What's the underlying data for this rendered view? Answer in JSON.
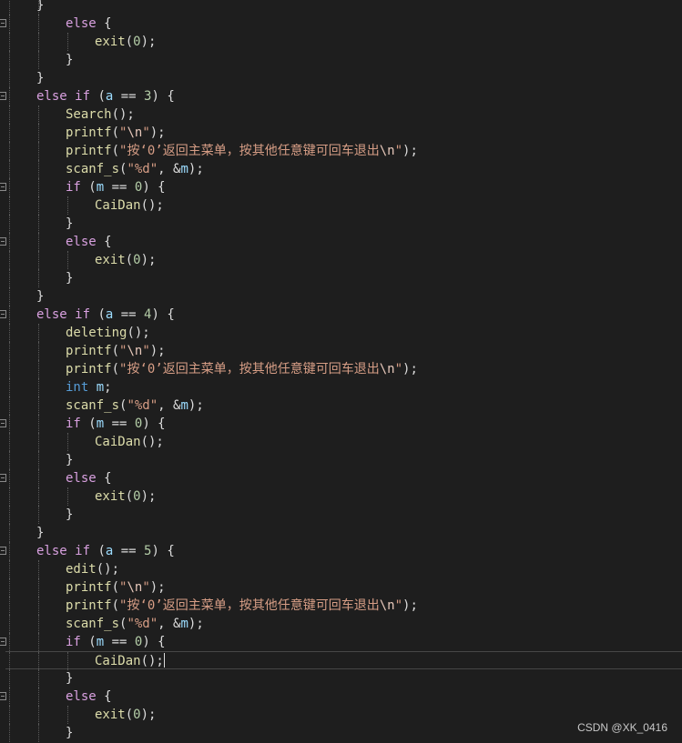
{
  "editor": {
    "lines": [
      {
        "fold": false,
        "guides": [
          2
        ],
        "tokens": [
          {
            "t": "}",
            "c": "punc"
          }
        ]
      },
      {
        "fold": true,
        "guides": [
          2
        ],
        "tokens": [
          {
            "t": "else",
            "c": "kw"
          },
          {
            "t": " {",
            "c": "punc"
          }
        ]
      },
      {
        "fold": false,
        "guides": [
          2,
          3
        ],
        "tokens": [
          {
            "t": "exit",
            "c": "fn"
          },
          {
            "t": "(",
            "c": "punc"
          },
          {
            "t": "0",
            "c": "num"
          },
          {
            "t": ");",
            "c": "punc"
          }
        ]
      },
      {
        "fold": false,
        "guides": [
          2
        ],
        "tokens": [
          {
            "t": "}",
            "c": "punc"
          }
        ]
      },
      {
        "fold": false,
        "guides": [],
        "tokens": [
          {
            "t": "}",
            "c": "punc"
          }
        ]
      },
      {
        "fold": true,
        "guides": [],
        "tokens": [
          {
            "t": "else",
            "c": "kw"
          },
          {
            "t": " ",
            "c": "punc"
          },
          {
            "t": "if",
            "c": "kw"
          },
          {
            "t": " (",
            "c": "punc"
          },
          {
            "t": "a",
            "c": "var"
          },
          {
            "t": " == ",
            "c": "punc"
          },
          {
            "t": "3",
            "c": "num"
          },
          {
            "t": ") {",
            "c": "punc"
          }
        ]
      },
      {
        "fold": false,
        "guides": [
          2
        ],
        "tokens": [
          {
            "t": "Search",
            "c": "fn"
          },
          {
            "t": "();",
            "c": "punc"
          }
        ]
      },
      {
        "fold": false,
        "guides": [
          2
        ],
        "tokens": [
          {
            "t": "printf",
            "c": "fn"
          },
          {
            "t": "(",
            "c": "punc"
          },
          {
            "t": "\"",
            "c": "str"
          },
          {
            "t": "\\n",
            "c": "esc"
          },
          {
            "t": "\"",
            "c": "str"
          },
          {
            "t": ");",
            "c": "punc"
          }
        ]
      },
      {
        "fold": false,
        "guides": [
          2
        ],
        "tokens": [
          {
            "t": "printf",
            "c": "fn"
          },
          {
            "t": "(",
            "c": "punc"
          },
          {
            "t": "\"按‘0’返回主菜单，按其他任意键可回车退出",
            "c": "str"
          },
          {
            "t": "\\n",
            "c": "esc"
          },
          {
            "t": "\"",
            "c": "str"
          },
          {
            "t": ");",
            "c": "punc"
          }
        ]
      },
      {
        "fold": false,
        "guides": [
          2
        ],
        "tokens": [
          {
            "t": "scanf_s",
            "c": "fn"
          },
          {
            "t": "(",
            "c": "punc"
          },
          {
            "t": "\"%d\"",
            "c": "str"
          },
          {
            "t": ", &",
            "c": "punc"
          },
          {
            "t": "m",
            "c": "var"
          },
          {
            "t": ");",
            "c": "punc"
          }
        ]
      },
      {
        "fold": true,
        "guides": [
          2
        ],
        "tokens": [
          {
            "t": "if",
            "c": "kw"
          },
          {
            "t": " (",
            "c": "punc"
          },
          {
            "t": "m",
            "c": "var"
          },
          {
            "t": " == ",
            "c": "punc"
          },
          {
            "t": "0",
            "c": "num"
          },
          {
            "t": ") {",
            "c": "punc"
          }
        ]
      },
      {
        "fold": false,
        "guides": [
          2,
          3
        ],
        "tokens": [
          {
            "t": "CaiDan",
            "c": "fn"
          },
          {
            "t": "();",
            "c": "punc"
          }
        ]
      },
      {
        "fold": false,
        "guides": [
          2
        ],
        "tokens": [
          {
            "t": "}",
            "c": "punc"
          }
        ]
      },
      {
        "fold": true,
        "guides": [
          2
        ],
        "tokens": [
          {
            "t": "else",
            "c": "kw"
          },
          {
            "t": " {",
            "c": "punc"
          }
        ]
      },
      {
        "fold": false,
        "guides": [
          2,
          3
        ],
        "tokens": [
          {
            "t": "exit",
            "c": "fn"
          },
          {
            "t": "(",
            "c": "punc"
          },
          {
            "t": "0",
            "c": "num"
          },
          {
            "t": ");",
            "c": "punc"
          }
        ]
      },
      {
        "fold": false,
        "guides": [
          2
        ],
        "tokens": [
          {
            "t": "}",
            "c": "punc"
          }
        ]
      },
      {
        "fold": false,
        "guides": [],
        "tokens": [
          {
            "t": "}",
            "c": "punc"
          }
        ]
      },
      {
        "fold": true,
        "guides": [],
        "tokens": [
          {
            "t": "else",
            "c": "kw"
          },
          {
            "t": " ",
            "c": "punc"
          },
          {
            "t": "if",
            "c": "kw"
          },
          {
            "t": " (",
            "c": "punc"
          },
          {
            "t": "a",
            "c": "var"
          },
          {
            "t": " == ",
            "c": "punc"
          },
          {
            "t": "4",
            "c": "num"
          },
          {
            "t": ") {",
            "c": "punc"
          }
        ]
      },
      {
        "fold": false,
        "guides": [
          2
        ],
        "tokens": [
          {
            "t": "deleting",
            "c": "fn"
          },
          {
            "t": "();",
            "c": "punc"
          }
        ]
      },
      {
        "fold": false,
        "guides": [
          2
        ],
        "tokens": [
          {
            "t": "printf",
            "c": "fn"
          },
          {
            "t": "(",
            "c": "punc"
          },
          {
            "t": "\"",
            "c": "str"
          },
          {
            "t": "\\n",
            "c": "esc"
          },
          {
            "t": "\"",
            "c": "str"
          },
          {
            "t": ");",
            "c": "punc"
          }
        ]
      },
      {
        "fold": false,
        "guides": [
          2
        ],
        "tokens": [
          {
            "t": "printf",
            "c": "fn"
          },
          {
            "t": "(",
            "c": "punc"
          },
          {
            "t": "\"按‘0’返回主菜单，按其他任意键可回车退出",
            "c": "str"
          },
          {
            "t": "\\n",
            "c": "esc"
          },
          {
            "t": "\"",
            "c": "str"
          },
          {
            "t": ");",
            "c": "punc"
          }
        ]
      },
      {
        "fold": false,
        "guides": [
          2
        ],
        "tokens": [
          {
            "t": "int",
            "c": "type"
          },
          {
            "t": " ",
            "c": "punc"
          },
          {
            "t": "m",
            "c": "var"
          },
          {
            "t": ";",
            "c": "punc"
          }
        ]
      },
      {
        "fold": false,
        "guides": [
          2
        ],
        "tokens": [
          {
            "t": "scanf_s",
            "c": "fn"
          },
          {
            "t": "(",
            "c": "punc"
          },
          {
            "t": "\"%d\"",
            "c": "str"
          },
          {
            "t": ", &",
            "c": "punc"
          },
          {
            "t": "m",
            "c": "var"
          },
          {
            "t": ");",
            "c": "punc"
          }
        ]
      },
      {
        "fold": true,
        "guides": [
          2
        ],
        "tokens": [
          {
            "t": "if",
            "c": "kw"
          },
          {
            "t": " (",
            "c": "punc"
          },
          {
            "t": "m",
            "c": "var"
          },
          {
            "t": " == ",
            "c": "punc"
          },
          {
            "t": "0",
            "c": "num"
          },
          {
            "t": ") {",
            "c": "punc"
          }
        ]
      },
      {
        "fold": false,
        "guides": [
          2,
          3
        ],
        "tokens": [
          {
            "t": "CaiDan",
            "c": "fn"
          },
          {
            "t": "();",
            "c": "punc"
          }
        ]
      },
      {
        "fold": false,
        "guides": [
          2
        ],
        "tokens": [
          {
            "t": "}",
            "c": "punc"
          }
        ]
      },
      {
        "fold": true,
        "guides": [
          2
        ],
        "tokens": [
          {
            "t": "else",
            "c": "kw"
          },
          {
            "t": " {",
            "c": "punc"
          }
        ]
      },
      {
        "fold": false,
        "guides": [
          2,
          3
        ],
        "tokens": [
          {
            "t": "exit",
            "c": "fn"
          },
          {
            "t": "(",
            "c": "punc"
          },
          {
            "t": "0",
            "c": "num"
          },
          {
            "t": ");",
            "c": "punc"
          }
        ]
      },
      {
        "fold": false,
        "guides": [
          2
        ],
        "tokens": [
          {
            "t": "}",
            "c": "punc"
          }
        ]
      },
      {
        "fold": false,
        "guides": [],
        "tokens": [
          {
            "t": "}",
            "c": "punc"
          }
        ]
      },
      {
        "fold": true,
        "guides": [],
        "tokens": [
          {
            "t": "else",
            "c": "kw"
          },
          {
            "t": " ",
            "c": "punc"
          },
          {
            "t": "if",
            "c": "kw"
          },
          {
            "t": " (",
            "c": "punc"
          },
          {
            "t": "a",
            "c": "var"
          },
          {
            "t": " == ",
            "c": "punc"
          },
          {
            "t": "5",
            "c": "num"
          },
          {
            "t": ") {",
            "c": "punc"
          }
        ]
      },
      {
        "fold": false,
        "guides": [
          2
        ],
        "tokens": [
          {
            "t": "edit",
            "c": "fn"
          },
          {
            "t": "();",
            "c": "punc"
          }
        ]
      },
      {
        "fold": false,
        "guides": [
          2
        ],
        "tokens": [
          {
            "t": "printf",
            "c": "fn"
          },
          {
            "t": "(",
            "c": "punc"
          },
          {
            "t": "\"",
            "c": "str"
          },
          {
            "t": "\\n",
            "c": "esc"
          },
          {
            "t": "\"",
            "c": "str"
          },
          {
            "t": ");",
            "c": "punc"
          }
        ]
      },
      {
        "fold": false,
        "guides": [
          2
        ],
        "tokens": [
          {
            "t": "printf",
            "c": "fn"
          },
          {
            "t": "(",
            "c": "punc"
          },
          {
            "t": "\"按‘0’返回主菜单，按其他任意键可回车退出",
            "c": "str"
          },
          {
            "t": "\\n",
            "c": "esc"
          },
          {
            "t": "\"",
            "c": "str"
          },
          {
            "t": ");",
            "c": "punc"
          }
        ]
      },
      {
        "fold": false,
        "guides": [
          2
        ],
        "tokens": [
          {
            "t": "scanf_s",
            "c": "fn"
          },
          {
            "t": "(",
            "c": "punc"
          },
          {
            "t": "\"%d\"",
            "c": "str"
          },
          {
            "t": ", &",
            "c": "punc"
          },
          {
            "t": "m",
            "c": "var"
          },
          {
            "t": ");",
            "c": "punc"
          }
        ]
      },
      {
        "fold": true,
        "guides": [
          2
        ],
        "tokens": [
          {
            "t": "if",
            "c": "kw"
          },
          {
            "t": " (",
            "c": "punc"
          },
          {
            "t": "m",
            "c": "var"
          },
          {
            "t": " == ",
            "c": "punc"
          },
          {
            "t": "0",
            "c": "num"
          },
          {
            "t": ") {",
            "c": "punc"
          }
        ]
      },
      {
        "fold": false,
        "guides": [
          2,
          3
        ],
        "current": true,
        "tokens": [
          {
            "t": "CaiDan",
            "c": "fn"
          },
          {
            "t": "();",
            "c": "punc"
          }
        ]
      },
      {
        "fold": false,
        "guides": [
          2
        ],
        "tokens": [
          {
            "t": "}",
            "c": "punc"
          }
        ]
      },
      {
        "fold": true,
        "guides": [
          2
        ],
        "tokens": [
          {
            "t": "else",
            "c": "kw"
          },
          {
            "t": " {",
            "c": "punc"
          }
        ]
      },
      {
        "fold": false,
        "guides": [
          2,
          3
        ],
        "tokens": [
          {
            "t": "exit",
            "c": "fn"
          },
          {
            "t": "(",
            "c": "punc"
          },
          {
            "t": "0",
            "c": "num"
          },
          {
            "t": ");",
            "c": "punc"
          }
        ]
      },
      {
        "fold": false,
        "guides": [
          2
        ],
        "tokens": [
          {
            "t": "}",
            "c": "punc"
          }
        ]
      }
    ],
    "indents": [
      2,
      3,
      4,
      3,
      2,
      2,
      3,
      3,
      3,
      3,
      3,
      4,
      3,
      3,
      4,
      3,
      2,
      2,
      3,
      3,
      3,
      3,
      3,
      3,
      4,
      3,
      3,
      4,
      3,
      2,
      2,
      3,
      3,
      3,
      3,
      3,
      4,
      3,
      3,
      4,
      3
    ]
  },
  "watermark": "CSDN @XK_0416"
}
